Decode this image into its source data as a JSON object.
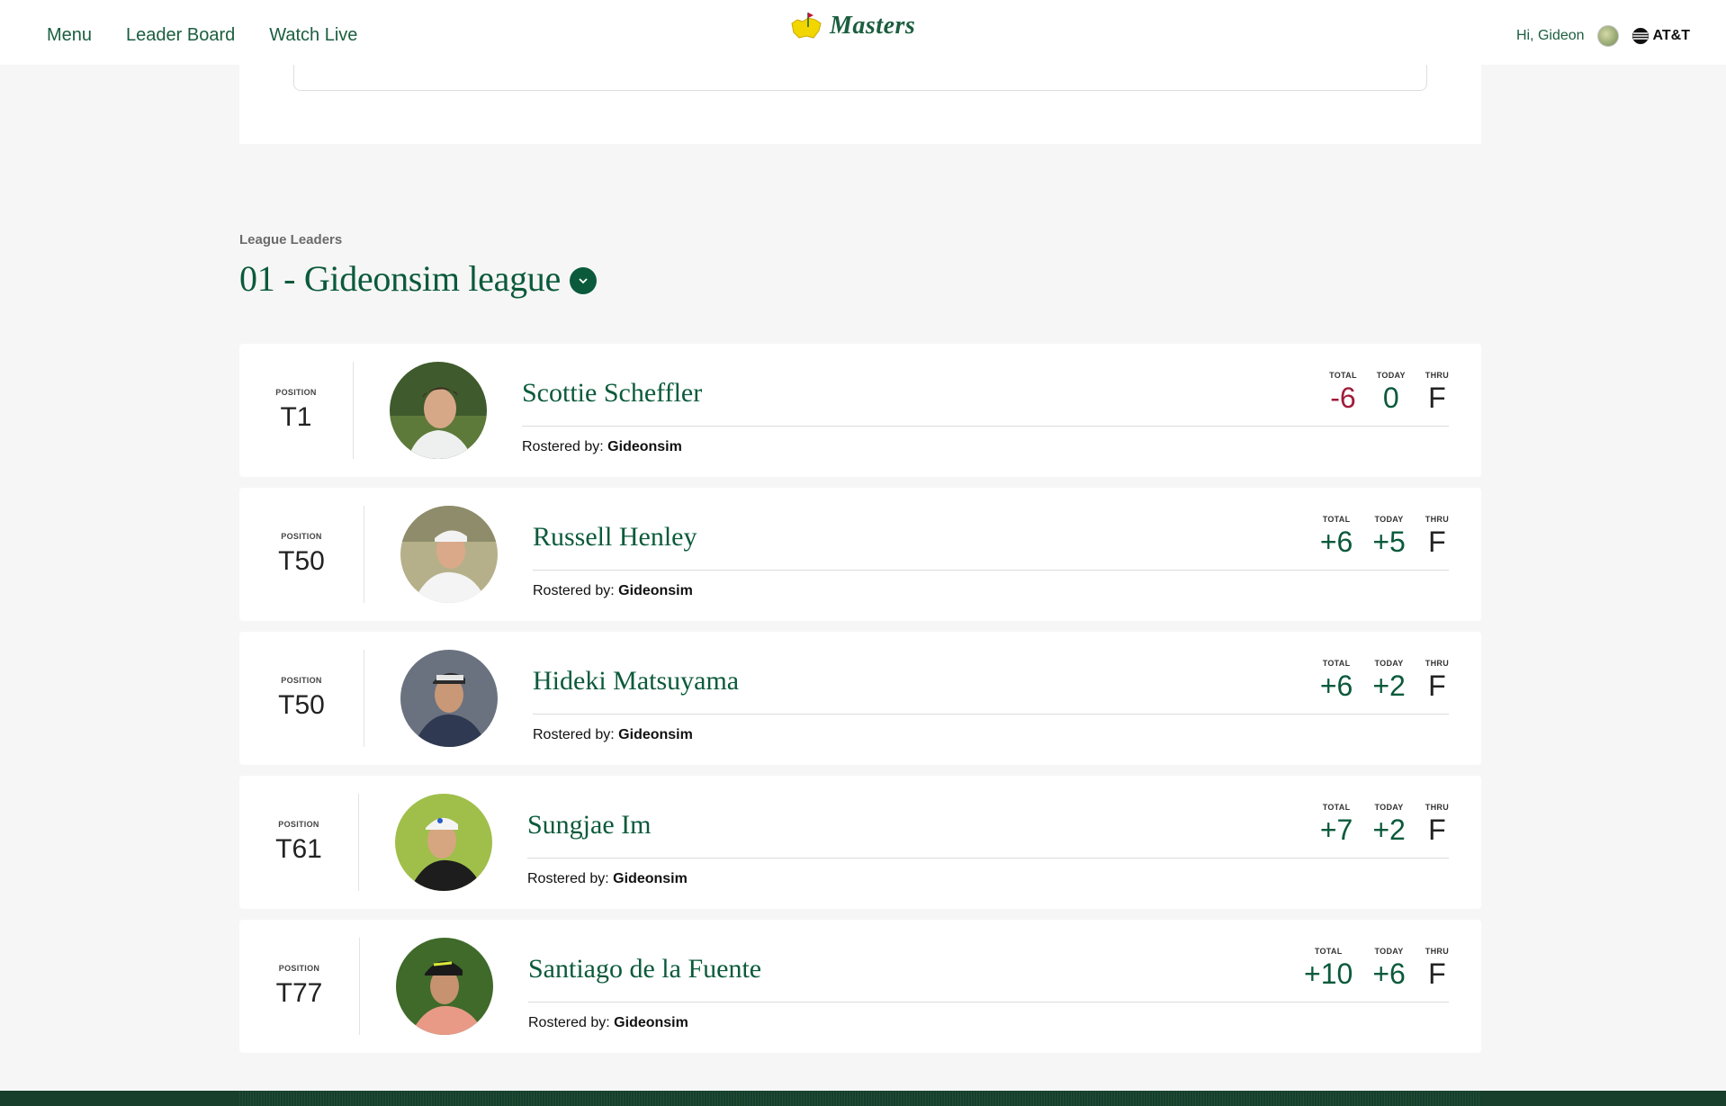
{
  "nav": {
    "menu": "Menu",
    "leaderboard": "Leader Board",
    "watch_live": "Watch Live"
  },
  "brand": {
    "logo_text": "Masters"
  },
  "user": {
    "greeting": "Hi, Gideon",
    "sponsor": "AT&T"
  },
  "section": {
    "label": "League Leaders",
    "league_title": "01 - Gideonsim league"
  },
  "labels": {
    "position": "POSITION",
    "total": "TOTAL",
    "today": "TODAY",
    "thru": "THRU",
    "rostered_by": "Rostered by:"
  },
  "players": [
    {
      "position": "T1",
      "name": "Scottie Scheffler",
      "total": "-6",
      "today": "0",
      "thru": "F",
      "rostered": "Gideonsim"
    },
    {
      "position": "T50",
      "name": "Russell Henley",
      "total": "+6",
      "today": "+5",
      "thru": "F",
      "rostered": "Gideonsim"
    },
    {
      "position": "T50",
      "name": "Hideki Matsuyama",
      "total": "+6",
      "today": "+2",
      "thru": "F",
      "rostered": "Gideonsim"
    },
    {
      "position": "T61",
      "name": "Sungjae Im",
      "total": "+7",
      "today": "+2",
      "thru": "F",
      "rostered": "Gideonsim"
    },
    {
      "position": "T77",
      "name": "Santiago de la Fuente",
      "total": "+10",
      "today": "+6",
      "thru": "F",
      "rostered": "Gideonsim"
    }
  ],
  "colors": {
    "brand_green": "#0b5a3b",
    "over_par": "#0b5a3b",
    "under_par": "#a01c3a"
  }
}
